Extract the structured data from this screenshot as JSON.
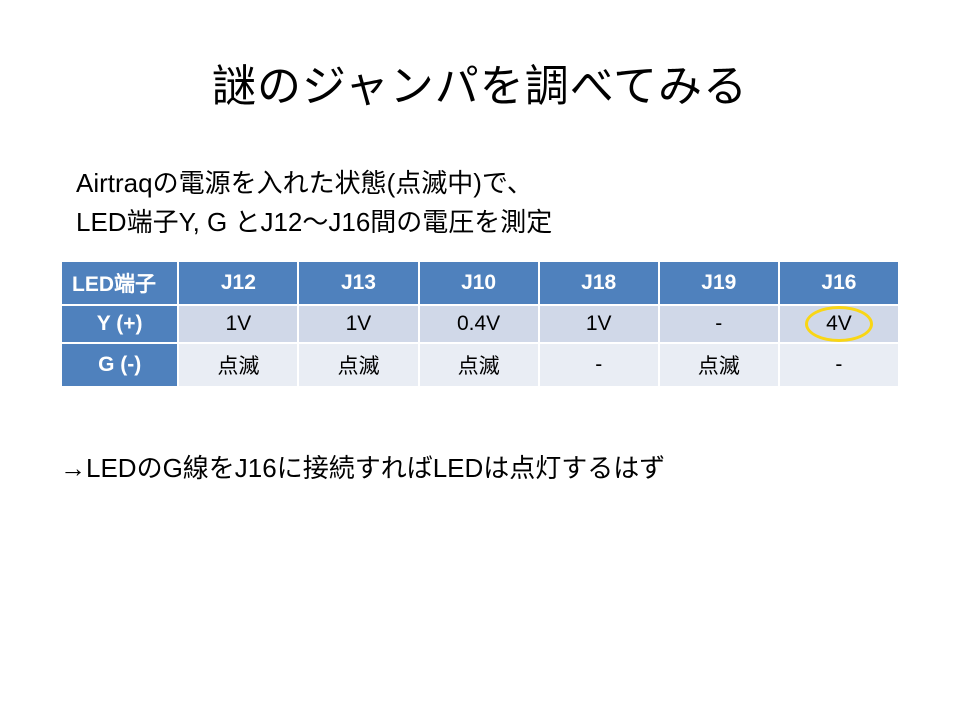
{
  "title": "謎のジャンパを調べてみる",
  "intro_line1": "Airtraqの電源を入れた状態(点滅中)で、",
  "intro_line2": "LED端子Y, G とJ12～J16間の電圧を測定",
  "conclusion": "→LEDのG線をJ16に接続すればLEDは点灯するはず",
  "table": {
    "header_label": "LED端子",
    "columns": [
      "J12",
      "J13",
      "J10",
      "J18",
      "J19",
      "J16"
    ],
    "rows": [
      {
        "label": "Y (+)",
        "cells": [
          "1V",
          "1V",
          "0.4V",
          "1V",
          "-",
          "4V"
        ]
      },
      {
        "label": "G (-)",
        "cells": [
          "点滅",
          "点滅",
          "点滅",
          "-",
          "点滅",
          "-"
        ]
      }
    ],
    "highlight": {
      "row": 0,
      "col": 5
    }
  },
  "chart_data": {
    "type": "table",
    "title": "LED端子 vs ジャンパ 電圧測定",
    "columns": [
      "LED端子",
      "J12",
      "J13",
      "J10",
      "J18",
      "J19",
      "J16"
    ],
    "rows": [
      [
        "Y (+)",
        "1V",
        "1V",
        "0.4V",
        "1V",
        "-",
        "4V"
      ],
      [
        "G (-)",
        "点滅",
        "点滅",
        "点滅",
        "-",
        "点滅",
        "-"
      ]
    ],
    "highlight_cell": {
      "row_label": "Y (+)",
      "column": "J16",
      "value": "4V"
    }
  }
}
